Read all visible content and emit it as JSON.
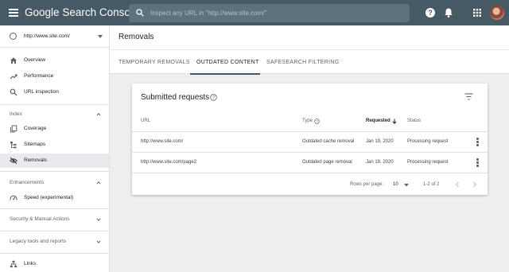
{
  "app": {
    "brand_google": "Google",
    "brand_product": "Search Console",
    "search_placeholder": "Inspect any URL in \"http://www.site.com/\""
  },
  "property": {
    "label": "http://www.site.com/"
  },
  "sidebar": {
    "items": [
      {
        "label": "Overview"
      },
      {
        "label": "Performance"
      },
      {
        "label": "URL inspection"
      }
    ],
    "index_section": "Index",
    "index_items": [
      {
        "label": "Coverage"
      },
      {
        "label": "Sitemaps"
      },
      {
        "label": "Removals"
      }
    ],
    "enhancements_section": "Enhancements",
    "enhancements_items": [
      {
        "label": "Speed (experimental)"
      }
    ],
    "security_section": "Security & Manual Actions",
    "legacy_section": "Legacy tools and reports",
    "links_label": "Links"
  },
  "main": {
    "title": "Removals",
    "tabs": [
      {
        "label": "TEMPORARY REMOVALS"
      },
      {
        "label": "OUTDATED CONTENT"
      },
      {
        "label": "SAFESEARCH FILTERING"
      }
    ],
    "active_tab": "OUTDATED CONTENT"
  },
  "table": {
    "title": "Submitted requests",
    "headers": {
      "url": "URL",
      "type": "Type",
      "requested": "Requested",
      "status": "Status"
    },
    "rows": [
      {
        "url": "http://www.site.com/",
        "type": "Outdated cache removal",
        "requested": "Jan 19, 2020",
        "status": "Processing request"
      },
      {
        "url": "http://www.site.com/page2",
        "type": "Outdated page removal",
        "requested": "Jan 19, 2020",
        "status": "Processing request"
      }
    ],
    "rows_per_page_label": "Rows per page:",
    "rows_per_page_value": "10",
    "range": "1-2 of 2"
  },
  "colors": {
    "topbar": "#455a64",
    "active_nav": "#e8eaed"
  }
}
